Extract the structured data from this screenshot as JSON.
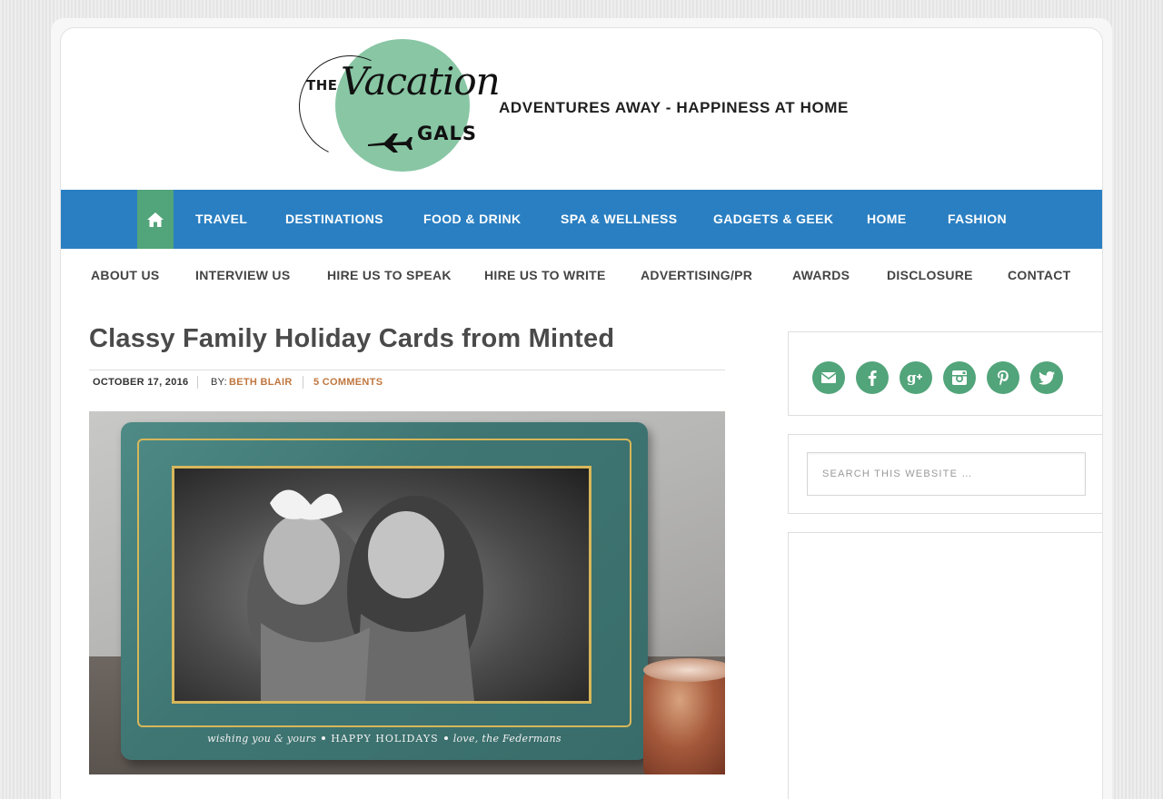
{
  "header": {
    "logo_the": "THE",
    "logo_vacation": "Vacation",
    "logo_gals": "GALS",
    "tagline": "ADVENTURES AWAY -  HAPPINESS AT HOME"
  },
  "nav_primary": {
    "home_icon": "home-icon",
    "items": [
      "TRAVEL",
      "DESTINATIONS",
      "FOOD & DRINK",
      "SPA & WELLNESS",
      "GADGETS & GEEK",
      "HOME",
      "FASHION"
    ]
  },
  "nav_secondary": {
    "items": [
      "ABOUT US",
      "INTERVIEW US",
      "HIRE US TO SPEAK",
      "HIRE US TO WRITE",
      "ADVERTISING/PR",
      "AWARDS",
      "DISCLOSURE",
      "CONTACT"
    ]
  },
  "post": {
    "title": "Classy Family Holiday Cards from Minted",
    "date": "OCTOBER 17, 2016",
    "by_label": "BY:",
    "author": "BETH BLAIR",
    "comments": "5 COMMENTS",
    "image": {
      "caption_left": "wishing you & yours",
      "caption_center": "HAPPY HOLIDAYS",
      "caption_right": "love, the Federmans"
    }
  },
  "sidebar": {
    "social_icons": [
      "email-icon",
      "facebook-icon",
      "google-plus-icon",
      "instagram-icon",
      "pinterest-icon",
      "twitter-icon"
    ],
    "search_placeholder": "SEARCH THIS WEBSITE …"
  },
  "colors": {
    "nav_blue": "#2a7fc2",
    "accent_green": "#52a47a",
    "logo_green": "#88c6a4",
    "link_orange": "#c0773f"
  }
}
